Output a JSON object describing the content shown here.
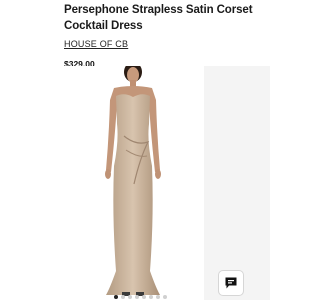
{
  "product": {
    "title_line1": "Persephone Strapless Satin Corset",
    "title_line2": "Cocktail Dress",
    "brand": "HOUSE OF CB",
    "price": "$329.00"
  },
  "gallery": {
    "image_subject": "model wearing champagne strapless corset gown",
    "dress_color": "#c9b29a",
    "dot_count": 8,
    "active_dot": 0
  },
  "chat": {
    "icon": "chat-icon"
  }
}
